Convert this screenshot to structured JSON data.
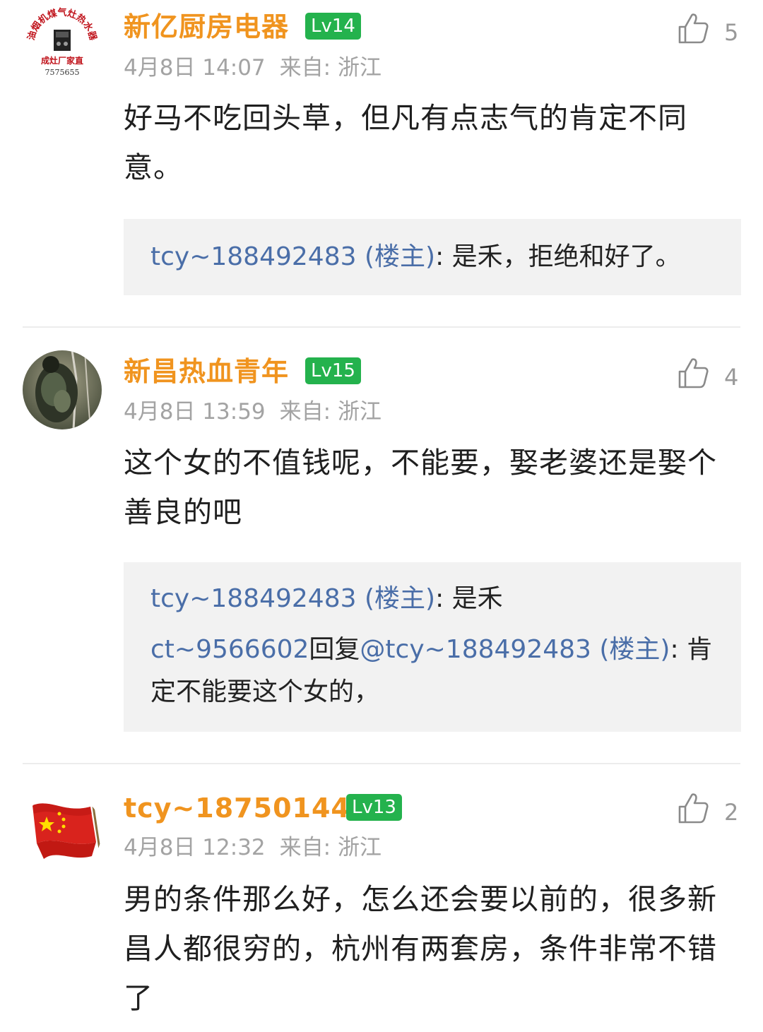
{
  "comments": [
    {
      "username": "新亿厨房电器",
      "level": "Lv14",
      "date": "4月8日 14:07",
      "source_label": "来自:",
      "source": "浙江",
      "likes": "5",
      "avatar_texts": [
        "油烟机煤气灶热水器",
        "成灶厂家直",
        "7575655"
      ],
      "text": "好马不吃回头草，但凡有点志气的肯定不同意。",
      "replies": [
        {
          "author": "tcy~188492483 (楼主)",
          "sep": ": ",
          "content": "是禾，拒绝和好了。"
        }
      ]
    },
    {
      "username": "新昌热血青年",
      "level": "Lv15",
      "date": "4月8日 13:59",
      "source_label": "来自:",
      "source": "浙江",
      "likes": "4",
      "text": "这个女的不值钱呢，不能要，娶老婆还是娶个善良的吧",
      "replies": [
        {
          "author": "tcy~188492483 (楼主)",
          "sep": ": ",
          "content": "是禾"
        },
        {
          "author": "ct~9566602",
          "reply_word": "回复",
          "mention": "@tcy~188492483 (楼主)",
          "sep": ": ",
          "content": "肯定不能要这个女的，"
        }
      ]
    },
    {
      "username": "tcy~187501448",
      "level": "Lv13",
      "date": "4月8日 12:32",
      "source_label": "来自:",
      "source": "浙江",
      "likes": "2",
      "text": "男的条件那么好，怎么还会要以前的，很多新昌人都很穷的，杭州有两套房，条件非常不错了"
    }
  ],
  "colors": {
    "username": "#f0941f",
    "badge": "#24b24d",
    "meta": "#a3a3a3",
    "link": "#4a6ea8",
    "reply_bg": "#f2f2f2"
  },
  "icons": {
    "like": "thumbs-up-outline-icon"
  }
}
